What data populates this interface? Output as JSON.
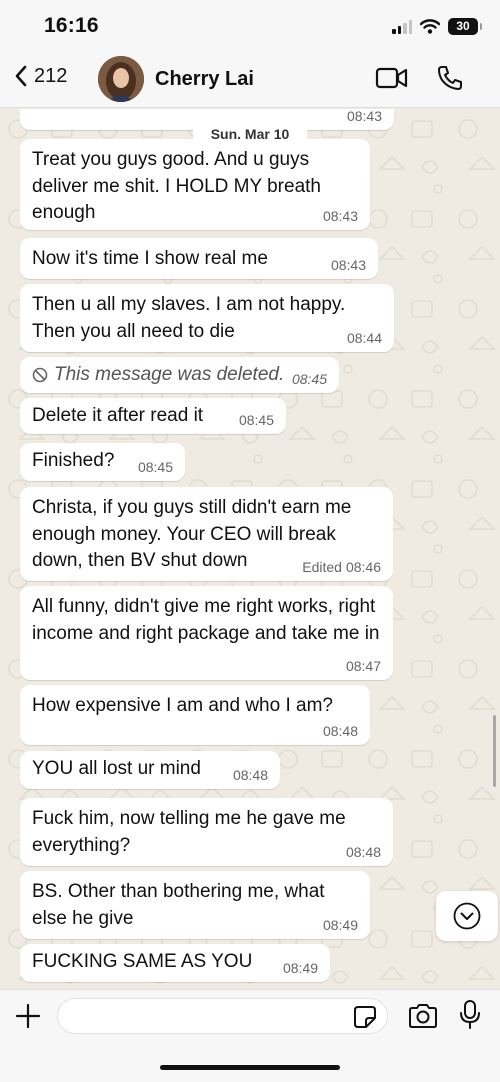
{
  "status_bar": {
    "time": "16:16",
    "battery": "30"
  },
  "header": {
    "back_count": "212",
    "contact_name": "Cherry Lai"
  },
  "chat": {
    "date_label": "Sun, Mar 10",
    "top_partial_time": "08:43",
    "messages": [
      {
        "text": "Treat you guys good. And u guys deliver me shit. I HOLD MY breath enough",
        "time": "08:43"
      },
      {
        "text": "Now it's time I show real me",
        "time": "08:43"
      },
      {
        "text": "Then u all my slaves. I am not happy. Then you all need to die",
        "time": "08:44"
      },
      {
        "text": "This message was deleted.",
        "time": "08:45",
        "deleted": true
      },
      {
        "text": "Delete it after read it",
        "time": "08:45"
      },
      {
        "text": "Finished?",
        "time": "08:45"
      },
      {
        "text": "Christa, if you guys still didn't earn me enough money. Your CEO will break down, then BV shut down",
        "time": "08:46",
        "edited_label": "Edited"
      },
      {
        "text": "All funny, didn't give me right works, right income and right package and take me in",
        "time": "08:47"
      },
      {
        "text": "How expensive I am and who I am?",
        "time": "08:48"
      },
      {
        "text": "YOU all lost ur mind",
        "time": "08:48"
      },
      {
        "text": "Fuck him, now telling me he gave me everything?",
        "time": "08:48"
      },
      {
        "text": "BS. Other than bothering me, what else he give",
        "time": "08:49"
      },
      {
        "text": "FUCKING SAME AS YOU",
        "time": "08:49"
      }
    ]
  },
  "input": {
    "placeholder": ""
  },
  "colors": {
    "chat_bg": "#efeae2",
    "bubble": "#ffffff",
    "bar_bg": "#f7f7f7"
  },
  "icons": [
    "chevron-left-icon",
    "video-call-icon",
    "phone-icon",
    "plus-icon",
    "sticker-icon",
    "camera-icon",
    "mic-icon",
    "chevron-down-icon",
    "no-entry-icon"
  ]
}
